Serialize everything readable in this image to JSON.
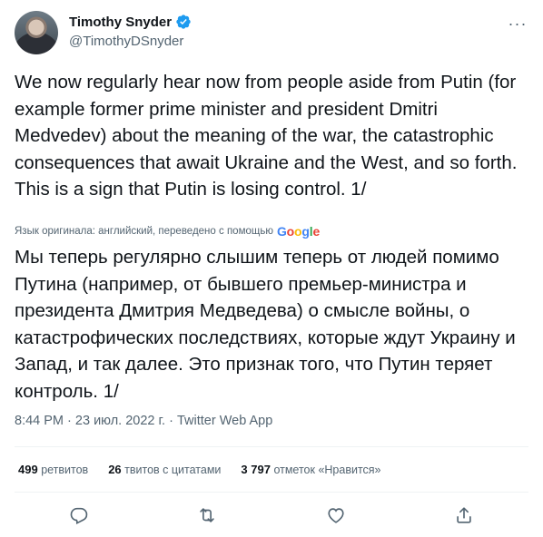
{
  "author": {
    "name": "Timothy Snyder",
    "handle": "@TimothyDSnyder",
    "verified": true
  },
  "tweet": {
    "text_en": "We now regularly hear now from people aside from Putin (for example former prime minister and president Dmitri Medvedev) about the meaning of the war, the catastrophic consequences that await Ukraine and the West, and so forth.  This is a sign that Putin is losing control. 1/",
    "translation_note": "Язык оригинала: английский, переведено с помощью",
    "translation_provider": "Google",
    "text_ru": "Мы теперь регулярно слышим теперь от людей помимо Путина (например, от бывшего премьер-министра и президента Дмитрия Медведева) о смысле войны, о катастрофических последствиях, которые ждут Украину и Запад, и так далее. Это признак того, что Путин теряет контроль. 1/",
    "time": "8:44 PM",
    "date": "23 июл. 2022 г.",
    "sep": "·",
    "source": "Twitter Web App"
  },
  "stats": {
    "retweets_count": "499",
    "retweets_label": "ретвитов",
    "quotes_count": "26",
    "quotes_label": "твитов с цитатами",
    "likes_count": "3 797",
    "likes_label": "отметок «Нравится»"
  },
  "colors": {
    "text": "#0f1419",
    "secondary": "#536471",
    "verified": "#1d9bf0",
    "divider": "#eff3f4"
  },
  "icons": [
    "verified-badge-icon",
    "more-icon",
    "reply-icon",
    "retweet-icon",
    "like-icon",
    "share-icon"
  ]
}
